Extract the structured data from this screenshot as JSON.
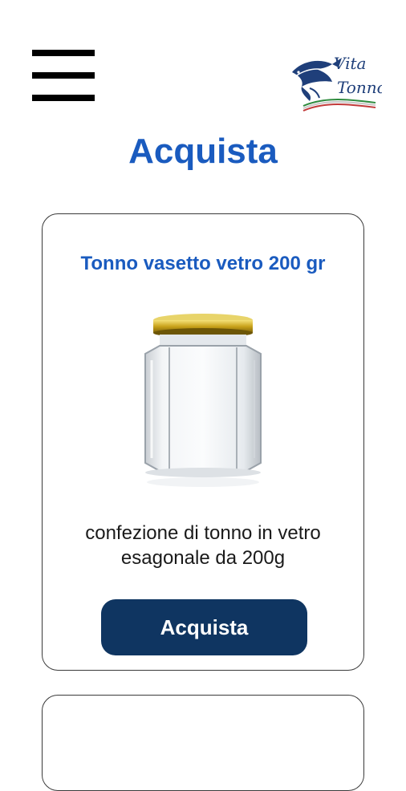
{
  "header": {
    "menu_icon": "hamburger-menu-icon",
    "logo_text_line1": "Vita",
    "logo_text_line2": "Tonno"
  },
  "page": {
    "title": "Acquista"
  },
  "products": [
    {
      "title": "Tonno vasetto vetro 200 gr",
      "image_icon": "glass-jar-image",
      "description_line1": "confezione di tonno in vetro",
      "description_line2": "esagonale da 200g",
      "button_label": "Acquista"
    }
  ],
  "colors": {
    "accent": "#1a5bbf",
    "button": "#0f3561",
    "text": "#1a1a1a"
  }
}
